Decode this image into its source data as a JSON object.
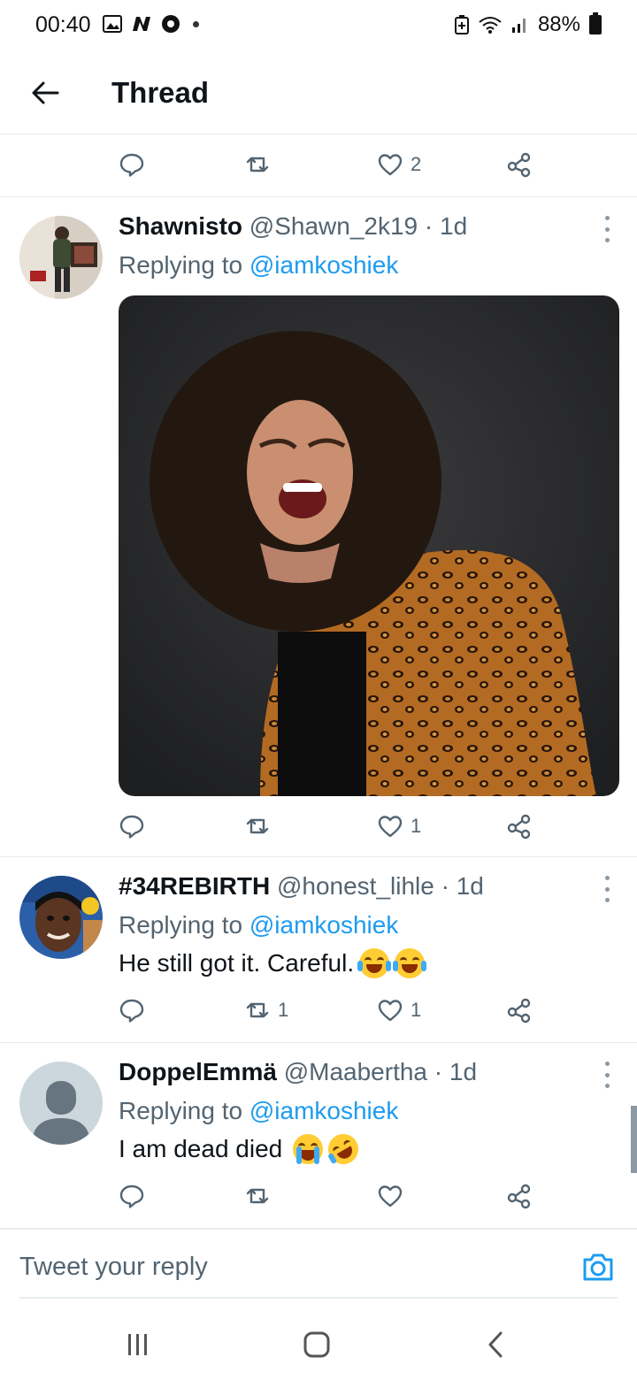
{
  "status_bar": {
    "time": "00:40",
    "battery": "88%",
    "left_icons": [
      "gallery-icon",
      "n-app-icon",
      "chrome-icon",
      "notification-dot"
    ],
    "right_icons": [
      "battery-saver-icon",
      "wifi-icon",
      "signal-icon",
      "battery-icon"
    ]
  },
  "header": {
    "title": "Thread"
  },
  "top_actions": {
    "like_count": "2"
  },
  "tweets": [
    {
      "name": "Shawnisto",
      "handle": "@Shawn_2k19",
      "time": "1d",
      "replying_prefix": "Replying to",
      "replying_to": "@iamkoshiek",
      "has_media": true,
      "retweet_count": "",
      "like_count": "1"
    },
    {
      "name": "#34REBIRTH",
      "handle": "@honest_lihle",
      "time": "1d",
      "replying_prefix": "Replying to",
      "replying_to": "@iamkoshiek",
      "text": "He still got it. Careful.",
      "emojis": [
        "tears-of-joy",
        "tears-of-joy"
      ],
      "retweet_count": "1",
      "like_count": "1"
    },
    {
      "name": "DoppelEmmä",
      "handle": "@Maabertha",
      "time": "1d",
      "replying_prefix": "Replying to",
      "replying_to": "@iamkoshiek",
      "text": "I am dead died",
      "emojis": [
        "loudly-crying",
        "rolling-on-floor-laughing"
      ],
      "retweet_count": "",
      "like_count": ""
    }
  ],
  "composer": {
    "placeholder": "Tweet your reply"
  },
  "colors": {
    "accent": "#1d9bf0",
    "secondary_text": "#536471",
    "primary_text": "#0f1419",
    "divider": "#e6ecf0"
  }
}
